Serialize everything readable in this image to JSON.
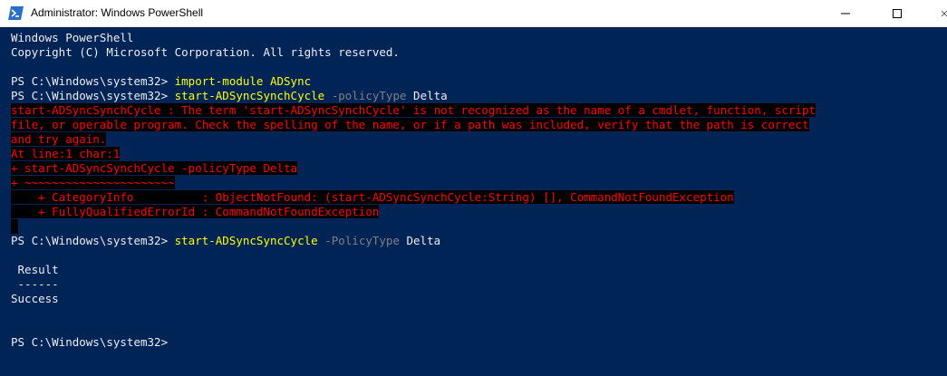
{
  "window": {
    "title": "Administrator: Windows PowerShell",
    "controls": {
      "minimize": "minimize",
      "maximize": "maximize",
      "close": "close"
    }
  },
  "console": {
    "banner1": "Windows PowerShell",
    "banner2": "Copyright (C) Microsoft Corporation. All rights reserved.",
    "prompt": "PS C:\\Windows\\system32> ",
    "cmd1": "import-module ADSync",
    "cmd2_name": "start-ADSyncSynchCycle",
    "cmd2_param": " -policyType",
    "cmd2_value": " Delta",
    "err1": "start-ADSyncSynchCycle : The term 'start-ADSyncSynchCycle' is not recognized as the name of a cmdlet, function, script",
    "err2": "file, or operable program. Check the spelling of the name, or if a path was included, verify that the path is correct",
    "err3": "and try again.",
    "err4": "At line:1 char:1",
    "err5": "+ start-ADSyncSynchCycle -policyType Delta",
    "err6": "+ ~~~~~~~~~~~~~~~~~~~~~~",
    "err7": "    + CategoryInfo          : ObjectNotFound: (start-ADSyncSynchCycle:String) [], CommandNotFoundException",
    "err8": "    + FullyQualifiedErrorId : CommandNotFoundException",
    "cmd3_name": "start-ADSyncSyncCycle",
    "cmd3_param": " -PolicyType",
    "cmd3_value": " Delta",
    "result_header": " Result",
    "result_sep": " ------",
    "result_value": "Success",
    "final_prompt": "PS C:\\Windows\\system32>"
  },
  "colors": {
    "background": "#012456",
    "text": "#eeedf0",
    "error_fg": "#ff0000",
    "error_bg": "#000000",
    "command": "#ffff00",
    "parameter": "#808080"
  }
}
